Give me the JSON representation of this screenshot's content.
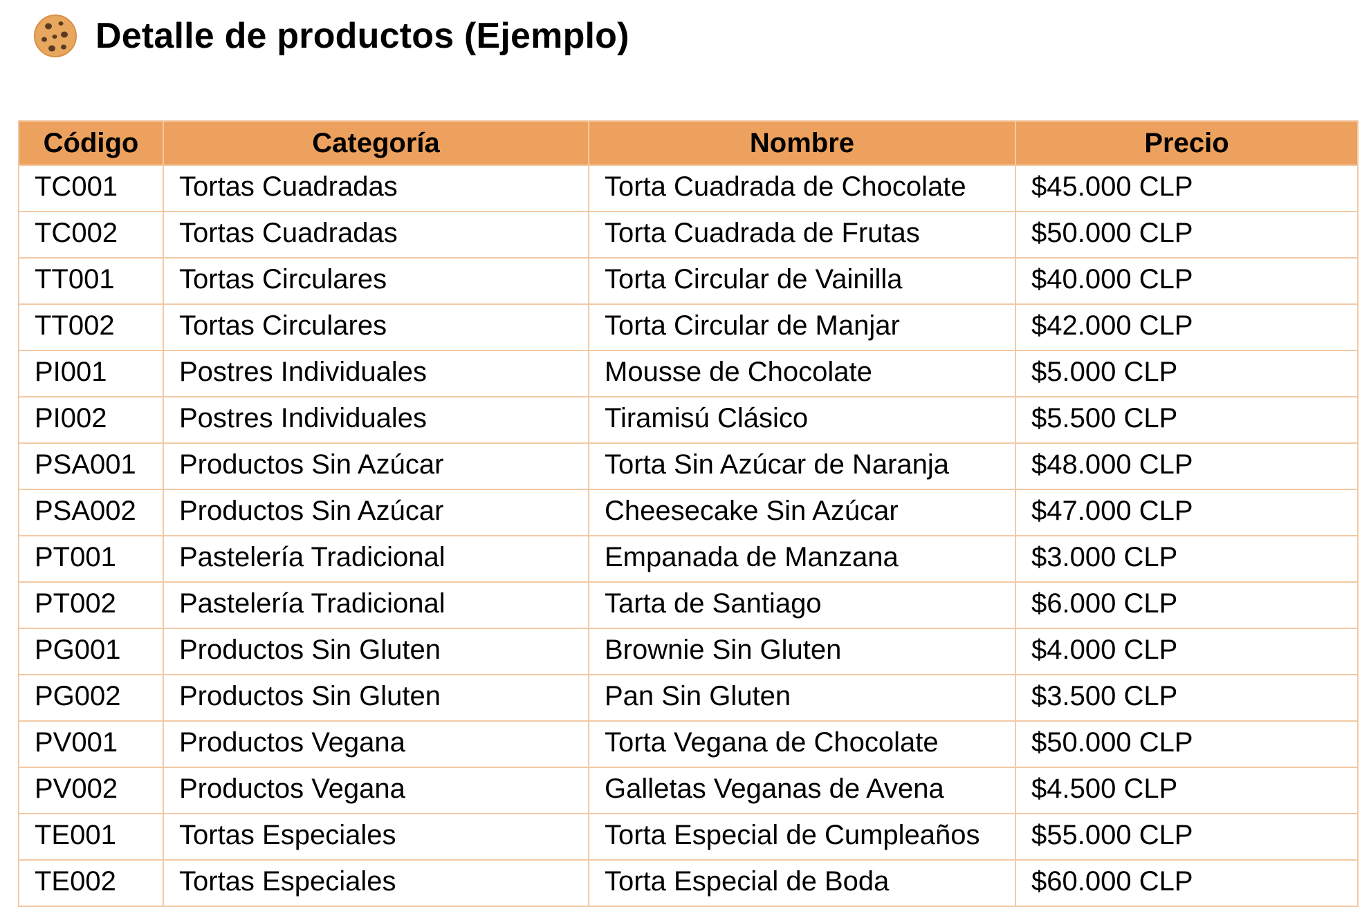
{
  "title": "Detalle de productos (Ejemplo)",
  "title_icon": "cookie-icon",
  "colors": {
    "header_background": "#eda15e",
    "border": "#f3c9a4",
    "cookie": "#e8a75e",
    "cookie_chips": "#5a3a22"
  },
  "table": {
    "headers": {
      "code": "Código",
      "category": "Categoría",
      "name": "Nombre",
      "price": "Precio"
    },
    "rows": [
      {
        "code": "TC001",
        "category": "Tortas Cuadradas",
        "name": "Torta Cuadrada de Chocolate",
        "price": "$45.000 CLP"
      },
      {
        "code": "TC002",
        "category": "Tortas Cuadradas",
        "name": "Torta Cuadrada de Frutas",
        "price": "$50.000 CLP"
      },
      {
        "code": "TT001",
        "category": "Tortas Circulares",
        "name": "Torta Circular de Vainilla",
        "price": "$40.000 CLP"
      },
      {
        "code": "TT002",
        "category": "Tortas Circulares",
        "name": "Torta Circular de Manjar",
        "price": "$42.000 CLP"
      },
      {
        "code": "PI001",
        "category": "Postres Individuales",
        "name": "Mousse de Chocolate",
        "price": "$5.000 CLP"
      },
      {
        "code": "PI002",
        "category": "Postres Individuales",
        "name": "Tiramisú Clásico",
        "price": "$5.500 CLP"
      },
      {
        "code": "PSA001",
        "category": "Productos Sin Azúcar",
        "name": "Torta Sin Azúcar de Naranja",
        "price": "$48.000 CLP"
      },
      {
        "code": "PSA002",
        "category": "Productos Sin Azúcar",
        "name": "Cheesecake Sin Azúcar",
        "price": "$47.000 CLP"
      },
      {
        "code": "PT001",
        "category": "Pastelería Tradicional",
        "name": "Empanada de Manzana",
        "price": "$3.000 CLP"
      },
      {
        "code": "PT002",
        "category": "Pastelería Tradicional",
        "name": "Tarta de Santiago",
        "price": "$6.000 CLP"
      },
      {
        "code": "PG001",
        "category": "Productos Sin Gluten",
        "name": "Brownie Sin Gluten",
        "price": "$4.000 CLP"
      },
      {
        "code": "PG002",
        "category": "Productos Sin Gluten",
        "name": "Pan Sin Gluten",
        "price": "$3.500 CLP"
      },
      {
        "code": "PV001",
        "category": "Productos Vegana",
        "name": "Torta Vegana de Chocolate",
        "price": "$50.000 CLP"
      },
      {
        "code": "PV002",
        "category": "Productos Vegana",
        "name": "Galletas Veganas de Avena",
        "price": "$4.500 CLP"
      },
      {
        "code": "TE001",
        "category": "Tortas Especiales",
        "name": "Torta Especial de Cumpleaños",
        "price": "$55.000 CLP"
      },
      {
        "code": "TE002",
        "category": "Tortas Especiales",
        "name": "Torta Especial de Boda",
        "price": "$60.000 CLP"
      }
    ]
  }
}
